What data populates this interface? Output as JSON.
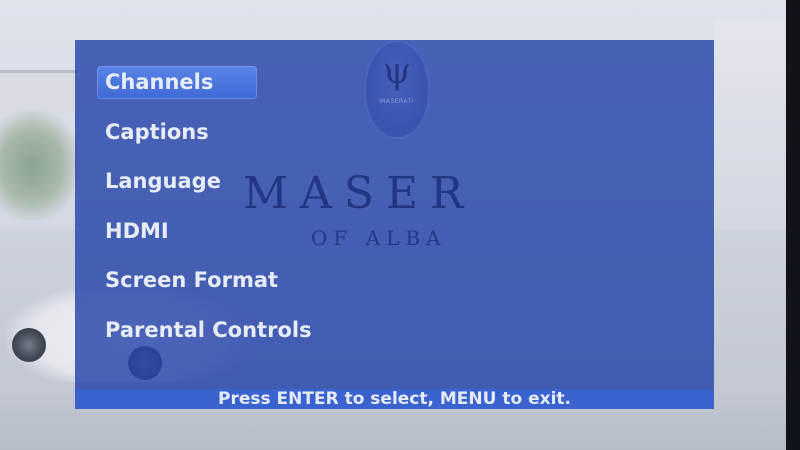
{
  "menu": {
    "items": [
      {
        "label": "Channels",
        "selected": true
      },
      {
        "label": "Captions",
        "selected": false
      },
      {
        "label": "Language",
        "selected": false
      },
      {
        "label": "HDMI",
        "selected": false
      },
      {
        "label": "Screen Format",
        "selected": false
      },
      {
        "label": "Parental Controls",
        "selected": false
      }
    ]
  },
  "footer": {
    "hint": "Press ENTER to select, MENU to exit."
  },
  "background": {
    "logo_word": "MASERATI",
    "sign_main": "MASER",
    "sign_sub": "OF ALBA"
  },
  "colors": {
    "panel": "#2644AA",
    "selection": "#4F78E0",
    "footer": "#3A63D0",
    "text": "#E8ECF8"
  },
  "icons": {
    "logo": "trident-logo-icon"
  }
}
